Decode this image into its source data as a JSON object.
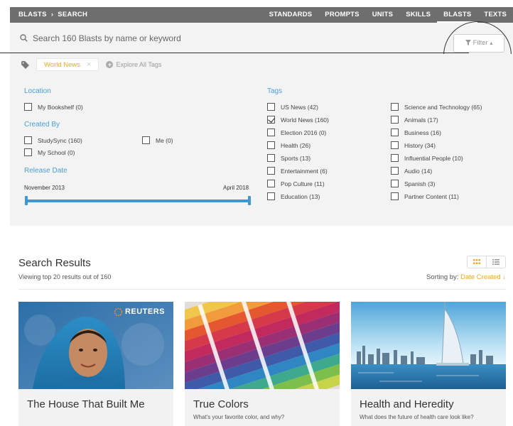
{
  "breadcrumb": {
    "root": "BLASTS",
    "separator": "›",
    "current": "SEARCH"
  },
  "nav": [
    {
      "label": "STANDARDS",
      "active": false
    },
    {
      "label": "PROMPTS",
      "active": false
    },
    {
      "label": "UNITS",
      "active": false
    },
    {
      "label": "SKILLS",
      "active": false
    },
    {
      "label": "BLASTS",
      "active": true
    },
    {
      "label": "TEXTS",
      "active": false
    }
  ],
  "search": {
    "placeholder": "Search 160 Blasts by name or keyword",
    "value": "",
    "icon": "search-icon"
  },
  "filter_button": {
    "label": "Filter",
    "icon": "funnel-icon",
    "caret": "▴"
  },
  "tag_filter": {
    "active_tag": "World News",
    "remove": "×",
    "explore_label": "Explore All Tags"
  },
  "filters": {
    "location": {
      "title": "Location",
      "options": [
        {
          "label": "My Bookshelf (0)",
          "checked": false
        }
      ]
    },
    "created_by": {
      "title": "Created By",
      "options": [
        {
          "label": "StudySync (160)",
          "checked": false
        },
        {
          "label": "Me (0)",
          "checked": false
        },
        {
          "label": "My School (0)",
          "checked": false
        }
      ]
    },
    "release_date": {
      "title": "Release Date",
      "start": "November 2013",
      "end": "April 2018",
      "range_start": 0.0,
      "range_end": 1.0
    },
    "tags": {
      "title": "Tags",
      "column1": [
        {
          "label": "US News (42)",
          "checked": false
        },
        {
          "label": "World News (160)",
          "checked": true
        },
        {
          "label": "Election 2016 (0)",
          "checked": false
        },
        {
          "label": "Health (26)",
          "checked": false
        },
        {
          "label": "Sports (13)",
          "checked": false
        },
        {
          "label": "Entertainment (6)",
          "checked": false
        },
        {
          "label": "Pop Culture (11)",
          "checked": false
        },
        {
          "label": "Education (13)",
          "checked": false
        }
      ],
      "column2": [
        {
          "label": "Science and Technology (65)",
          "checked": false
        },
        {
          "label": "Animals (17)",
          "checked": false
        },
        {
          "label": "Business (16)",
          "checked": false
        },
        {
          "label": "History (34)",
          "checked": false
        },
        {
          "label": "Influential People (10)",
          "checked": false
        },
        {
          "label": "Audio (14)",
          "checked": false
        },
        {
          "label": "Spanish (3)",
          "checked": false
        },
        {
          "label": "Partner Content (11)",
          "checked": false
        }
      ]
    }
  },
  "results": {
    "title": "Search Results",
    "count_text": "Viewing top 20 results out of 160",
    "sorting_label": "Sorting by:",
    "sorting_value": "Date Created ↓",
    "view_modes": [
      "grid-view-icon",
      "list-view-icon"
    ],
    "active_view": "grid",
    "cards": [
      {
        "title": "The House That Built Me",
        "subtitle": "",
        "badge": "REUTERS",
        "image": "portrait photo"
      },
      {
        "title": "True Colors",
        "subtitle": "What's your favorite color, and why?",
        "image": "color swatches"
      },
      {
        "title": "Health and Heredity",
        "subtitle": "What does the future of health care look like?",
        "image": "city skyline"
      }
    ]
  },
  "colors": {
    "accent": "#f5a623",
    "link_blue": "#4a9fd8",
    "nav_bg": "#6e6e6e",
    "panel_bg": "#f3f3f3",
    "slider": "#3d96d6"
  }
}
